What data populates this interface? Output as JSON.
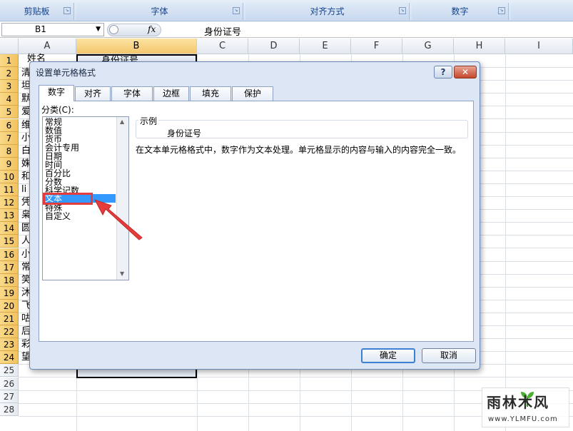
{
  "ribbon": {
    "groups": [
      "剪贴板",
      "字体",
      "对齐方式",
      "数字"
    ]
  },
  "formula_bar": {
    "name_box": "B1",
    "fx_label": "fx",
    "value": "身份证号"
  },
  "columns": [
    "A",
    "B",
    "C",
    "D",
    "E",
    "F",
    "G",
    "H",
    "I"
  ],
  "rows": [
    "1",
    "2",
    "3",
    "4",
    "5",
    "6",
    "7",
    "8",
    "9",
    "10",
    "11",
    "12",
    "13",
    "14",
    "15",
    "16",
    "17",
    "18",
    "19",
    "20",
    "21",
    "22",
    "23",
    "24",
    "25",
    "26",
    "27",
    "28"
  ],
  "cells": {
    "A1": "姓名",
    "B1": "身份证号",
    "A_col": [
      "清",
      "坦",
      "默",
      "爱",
      "维",
      "小",
      "白",
      "姝",
      "和",
      "li",
      "凭",
      "枭",
      "圆",
      "人",
      "小",
      "常",
      "笑",
      "沐",
      "飞",
      "咕",
      "后",
      "彩",
      "望远方"
    ]
  },
  "dialog": {
    "title": "设置单元格格式",
    "help_label": "?",
    "close_label": "✕",
    "tabs": [
      "数字",
      "对齐",
      "字体",
      "边框",
      "填充",
      "保护"
    ],
    "active_tab": "数字",
    "category_label": "分类(C):",
    "categories": [
      "常规",
      "数值",
      "货币",
      "会计专用",
      "日期",
      "时间",
      "百分比",
      "分数",
      "科学记数",
      "文本",
      "特殊",
      "自定义"
    ],
    "selected_category": "文本",
    "sample_label": "示例",
    "sample_value": "身份证号",
    "description": "在文本单元格格式中，数字作为文本处理。单元格显示的内容与输入的内容完全一致。",
    "ok_label": "确定",
    "cancel_label": "取消"
  },
  "watermark": {
    "title": "雨林木风",
    "url": "www.YLMFU.com"
  },
  "colors": {
    "highlight_box": "#e53c3c",
    "selection": "#3399ff",
    "arrow": "#e53c3c"
  }
}
